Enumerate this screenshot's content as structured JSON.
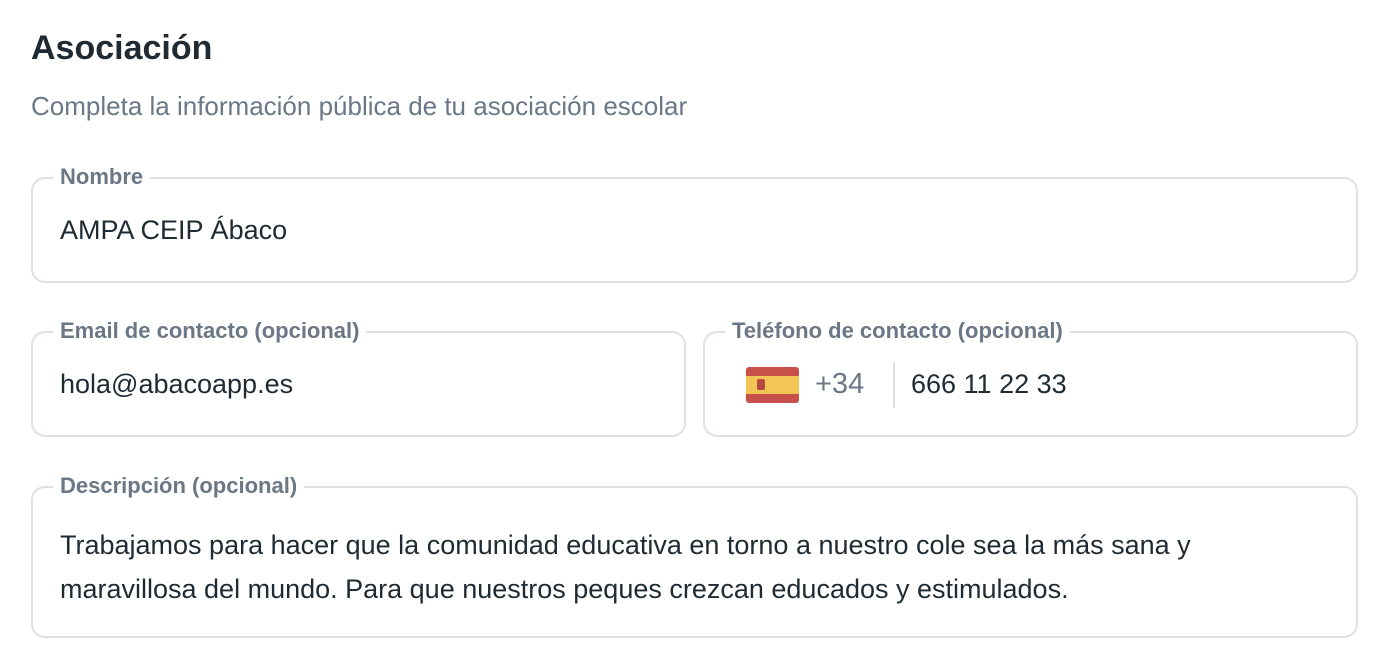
{
  "section": {
    "title": "Asociación",
    "subtitle": "Completa la información pública de tu asociación escolar"
  },
  "form": {
    "name": {
      "label": "Nombre",
      "value": "AMPA CEIP Ábaco"
    },
    "email": {
      "label": "Email de contacto (opcional)",
      "value": "hola@abacoapp.es"
    },
    "phone": {
      "label": "Teléfono de contacto (opcional)",
      "country_icon": "spain-flag-icon",
      "dial_code": "+34",
      "value": "666 11 22 33"
    },
    "description": {
      "label": "Descripción (opcional)",
      "value": "Trabajamos para hacer que la comunidad educativa en torno a nuestro cole sea la más sana y maravillosa del mundo. Para que nuestros peques crezcan educados y estimulados."
    }
  },
  "colors": {
    "flag_red": "#c8504a",
    "flag_yellow": "#f1c654",
    "emblem": "#b8473f",
    "border": "#dde1e6",
    "label": "#6b7785",
    "text": "#1f2a33"
  }
}
